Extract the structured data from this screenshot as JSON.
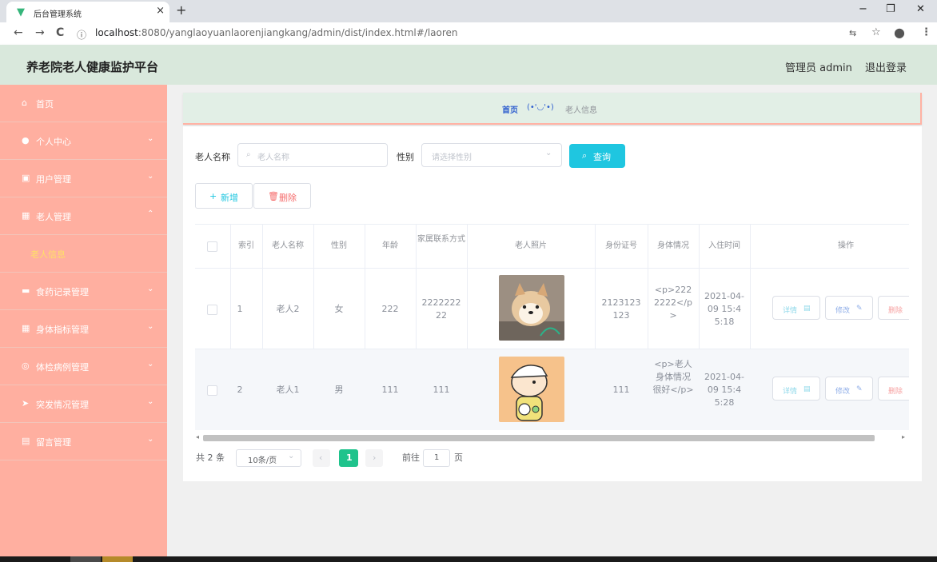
{
  "browser": {
    "tab_title": "后台管理系统",
    "tab_close": "×",
    "new_tab": "+",
    "url_host": "localhost",
    "url_port": ":8080",
    "url_path": "/yanglaoyuanlaorenjiangkang/admin/dist/index.html#/laoren",
    "nav_back": "←",
    "nav_forward": "→",
    "nav_reload": "C",
    "info_icon": "ⓘ",
    "win_minimize": "−",
    "win_restore": "❐",
    "win_close": "✕"
  },
  "header": {
    "app_title": "养老院老人健康监护平台",
    "admin_label": "管理员 admin",
    "logout_label": "退出登录"
  },
  "sidebar": {
    "items": [
      {
        "label": "首页",
        "icon": "home-icon"
      },
      {
        "label": "个人中心",
        "icon": "user-icon"
      },
      {
        "label": "用户管理",
        "icon": "clipboard-icon"
      },
      {
        "label": "老人管理",
        "icon": "grid-icon"
      },
      {
        "label": "老人信息",
        "icon": ""
      },
      {
        "label": "食药记录管理",
        "icon": "briefcase-icon"
      },
      {
        "label": "身体指标管理",
        "icon": "table-icon"
      },
      {
        "label": "体检病例管理",
        "icon": "compass-icon"
      },
      {
        "label": "突发情况管理",
        "icon": "send-icon"
      },
      {
        "label": "留言管理",
        "icon": "doc-icon"
      }
    ]
  },
  "breadcrumb": {
    "home": "首页",
    "face": "(•'◡'•)",
    "current": "老人信息"
  },
  "search": {
    "name_label": "老人名称",
    "name_placeholder": "老人名称",
    "gender_label": "性别",
    "gender_placeholder": "请选择性别",
    "search_button": "查询"
  },
  "actions": {
    "add": "新增",
    "delete": "删除"
  },
  "table": {
    "headers": [
      "索引",
      "老人名称",
      "性别",
      "年龄",
      "家属联系方式",
      "老人照片",
      "身份证号",
      "身体情况",
      "入住时间",
      "操作"
    ],
    "rows": [
      {
        "index": "1",
        "name": "老人2",
        "gender": "女",
        "age": "222",
        "contact": "222222222",
        "id_number": "2123123123",
        "condition": "<p>2222222</p>",
        "checkin": "2021-04-09 15:45:18",
        "photo": "dog-photo"
      },
      {
        "index": "2",
        "name": "老人1",
        "gender": "男",
        "age": "111",
        "contact": "111",
        "id_number": "111",
        "condition": "<p>老人身体情况很好</p>",
        "checkin": "2021-04-09 15:45:28",
        "photo": "cartoon-photo"
      }
    ],
    "row_buttons": {
      "detail": "详情",
      "edit": "修改",
      "delete": "删除"
    }
  },
  "pagination": {
    "total": "共 2 条",
    "page_size": "10条/页",
    "current_page": "1",
    "goto_label": "前往",
    "goto_value": "1",
    "page_suffix": "页"
  }
}
